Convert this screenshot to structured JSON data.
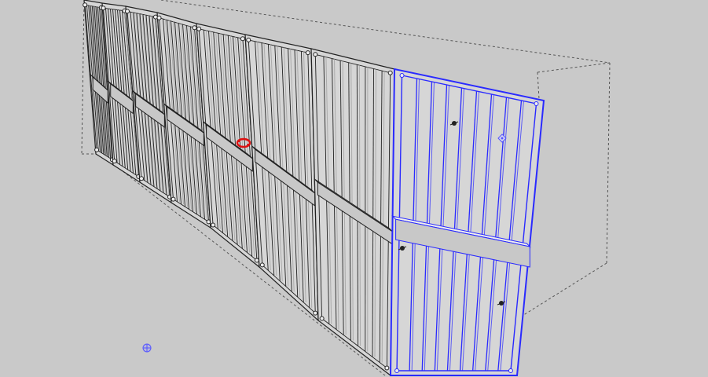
{
  "viewport": {
    "background": "#c9c9c9",
    "panel_face": "#d6d6d6",
    "panel_shadow": "#9a9a9a",
    "edge_color": "#222222",
    "selection_color": "#2a2aff",
    "bounding_box_color": "#555555",
    "rail_top": "#eeeeee",
    "rail_front": "#c8c8c8"
  },
  "scene": {
    "panel_count": 8,
    "selected_panel_index": 8,
    "icons": [
      "rotate-cursor-icon",
      "axis-origin-icon",
      "component-insertion-point-icon",
      "sun-shading-icon"
    ]
  }
}
